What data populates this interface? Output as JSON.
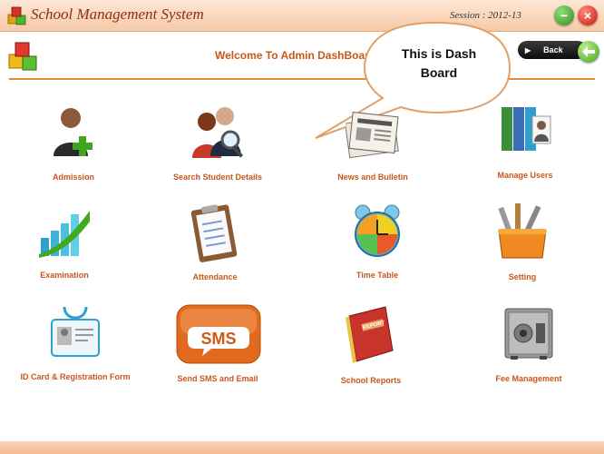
{
  "app": {
    "title": "School Management System",
    "session": "Session : 2012-13"
  },
  "header": {
    "welcome": "Welcome To Admin DashBoard",
    "back_label": "Back"
  },
  "callout": {
    "line1": "This is Dash",
    "line2": "Board"
  },
  "tiles": [
    {
      "label": "Admission",
      "icon": "admission-user-add-icon"
    },
    {
      "label": "Search Student Details",
      "icon": "search-students-icon"
    },
    {
      "label": "News and Bulletin",
      "icon": "newspaper-icon"
    },
    {
      "label": "Manage Users",
      "icon": "binders-users-icon"
    },
    {
      "label": "Examination",
      "icon": "bar-chart-icon"
    },
    {
      "label": "Attendance",
      "icon": "clipboard-icon"
    },
    {
      "label": "Time Table",
      "icon": "alarm-clock-icon"
    },
    {
      "label": "Setting",
      "icon": "toolbox-icon"
    },
    {
      "label": "ID Card & Registration Form",
      "icon": "id-card-icon"
    },
    {
      "label": "Send SMS and Email",
      "icon": "sms-icon"
    },
    {
      "label": "School Reports",
      "icon": "report-book-icon"
    },
    {
      "label": "Fee Management",
      "icon": "safe-icon"
    }
  ],
  "colors": {
    "accent": "#c9571b",
    "title_bar": "#f6c9a6",
    "rule": "#e08a3a"
  }
}
